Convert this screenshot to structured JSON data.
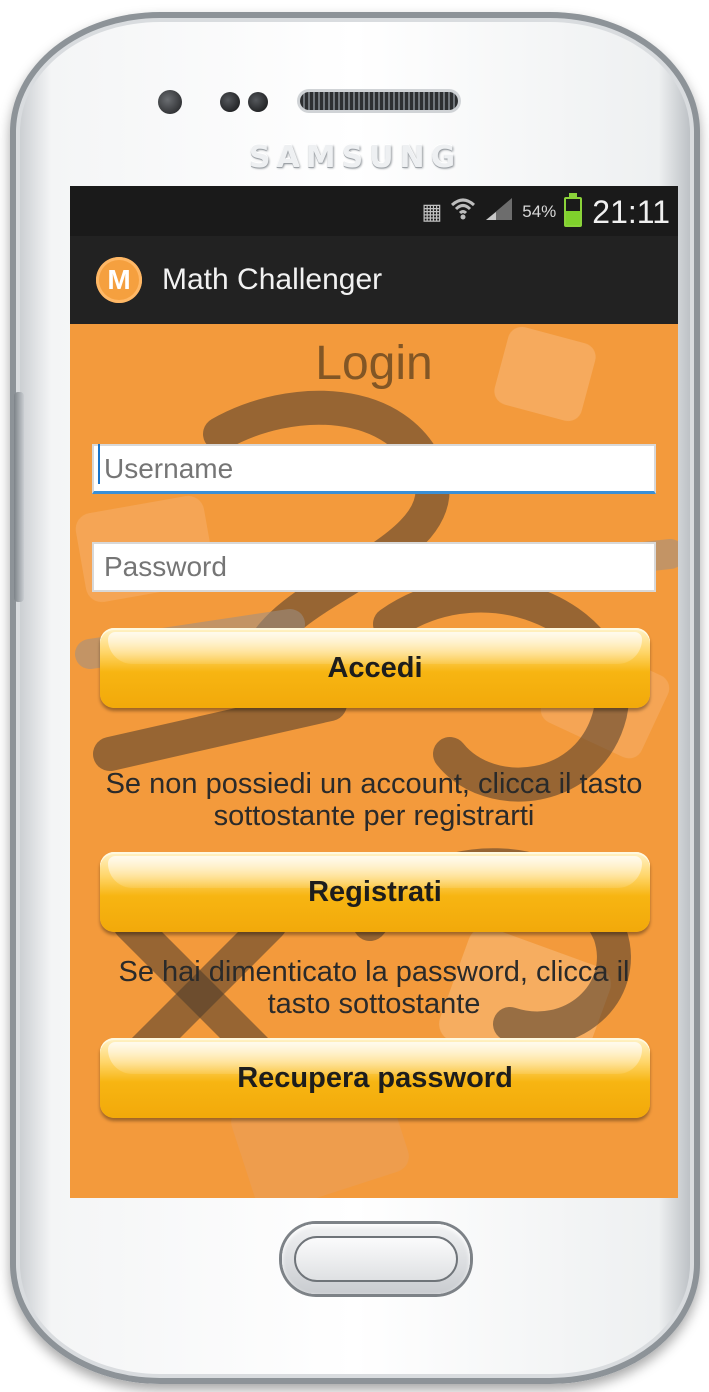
{
  "device": {
    "brand": "SAMSUNG"
  },
  "statusbar": {
    "battery_percent": "54%",
    "battery_level": 0.54,
    "time": "21:11",
    "icons": [
      "notification-icon",
      "wifi-icon",
      "signal-icon",
      "battery-icon"
    ]
  },
  "actionbar": {
    "logo_letter": "M",
    "title": "Math Challenger"
  },
  "login": {
    "title": "Login",
    "username_placeholder": "Username",
    "password_placeholder": "Password",
    "login_button": "Accedi",
    "register_info": "Se non possiedi un account, clicca il tasto sottostante per registrarti",
    "register_button": "Registrati",
    "recover_info": "Se hai dimenticato la password, clicca il tasto sottostante",
    "recover_button": "Recupera password"
  },
  "colors": {
    "screen_bg": "#f39a3c",
    "actionbar_bg": "#222222",
    "button_gold": "#f7b512",
    "battery_green": "#7fd12c"
  }
}
